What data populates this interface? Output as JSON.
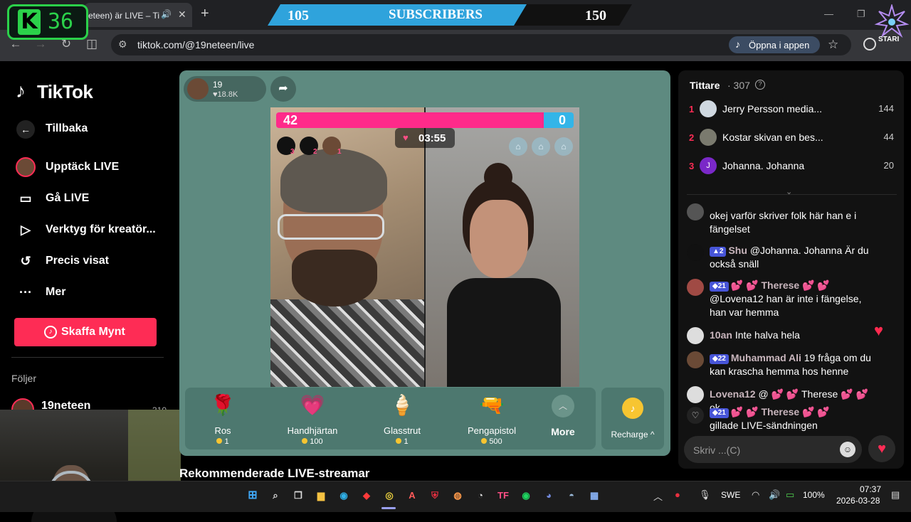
{
  "browser": {
    "tab_title": "eteen) är LIVE – TikTok",
    "url": "tiktok.com/@19neteen/live",
    "open_app_label": "Öppna i appen"
  },
  "overlay": {
    "k_letter": "K",
    "k_number": "36",
    "sub_left": "105",
    "sub_label": "SUBSCRIBERS",
    "sub_right": "150",
    "sub_progress": 0.7,
    "stari_text": "STARI"
  },
  "sidebar": {
    "logo": "TikTok",
    "back": "Tillbaka",
    "items": [
      {
        "label": "Upptäck LIVE",
        "icon": "avatar-icon"
      },
      {
        "label": "Gå LIVE",
        "icon": "camera-icon"
      },
      {
        "label": "Verktyg för kreatör...",
        "icon": "play-icon"
      },
      {
        "label": "Precis visat",
        "icon": "history-icon"
      },
      {
        "label": "Mer",
        "icon": "more-icon"
      }
    ],
    "coins_button": "Skaffa Mynt",
    "following_title": "Följer",
    "following_user": "19neteen",
    "following_count": "310"
  },
  "live": {
    "host_name": "19",
    "host_likes": "18.8K",
    "battle_left": "42",
    "battle_right": "0",
    "battle_left_fraction": 0.9,
    "timer": "03:55",
    "ranks": [
      "3",
      "2",
      "1"
    ],
    "gifts": [
      {
        "emoji": "🌹",
        "name": "Ros",
        "price": "1"
      },
      {
        "emoji": "💗",
        "name": "Handhjärtan",
        "price": "100"
      },
      {
        "emoji": "🍦",
        "name": "Glasstrut",
        "price": "1"
      },
      {
        "emoji": "🔫",
        "name": "Pengapistol",
        "price": "500"
      }
    ],
    "more_label": "More",
    "recharge_label": "Recharge ^",
    "recommended": "Rekommenderade LIVE-streamar"
  },
  "viewers": {
    "title": "Tittare",
    "count": "· 307",
    "list": [
      {
        "rank": "1",
        "name": "Jerry Persson media...",
        "score": "144",
        "color": "#cfd8e0"
      },
      {
        "rank": "2",
        "name": "Kostar skivan en bes...",
        "score": "44",
        "color": "#7a7a6e"
      },
      {
        "rank": "3",
        "name": "Johanna. Johanna",
        "score": "20",
        "color": "#7a28c8"
      }
    ]
  },
  "chat": {
    "messages": [
      {
        "user": "",
        "badge": "",
        "text": "okej varför skriver folk här han e i fängelset",
        "avatar_color": "#555"
      },
      {
        "user": "Shu",
        "badge": "2",
        "text": "@Johanna. Johanna Är du också snäll",
        "avatar_color": "#111"
      },
      {
        "user": "Therese",
        "badge": "21",
        "text": "@Lovena12 han är inte i fängelse, han var hemma",
        "avatar_color": "#a04a44"
      },
      {
        "user": "10an",
        "badge": "",
        "text": "Inte halva hela",
        "avatar_color": "#ddd"
      },
      {
        "user": "Muhammad Ali",
        "badge": "22",
        "text": "19 fråga om du kan krascha hemma hos henne",
        "avatar_color": "#6a4a36"
      },
      {
        "user": "Lovena12",
        "badge": "",
        "text": "@ 💕 💕 Therese 💕 💕 ok",
        "avatar_color": "#ddd"
      },
      {
        "user": "Therese",
        "badge": "21",
        "text": "gillade LIVE-sändningen",
        "avatar_color": "#222"
      }
    ],
    "input_placeholder": "Skriv ...(C)"
  },
  "taskbar": {
    "lang": "SWE",
    "battery": "100%",
    "time": "07:37",
    "date": "2026-03-28"
  }
}
